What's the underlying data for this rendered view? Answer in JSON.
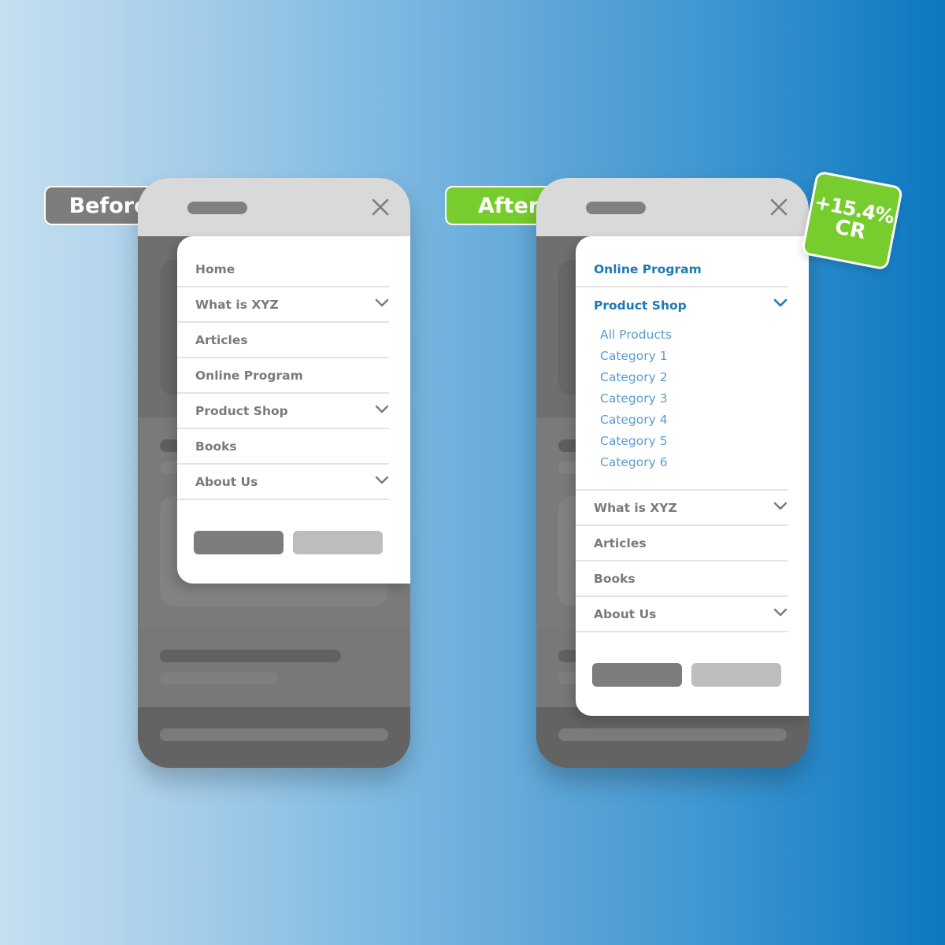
{
  "colors": {
    "accent_blue": "#1e78b8",
    "sub_blue": "#5a9ccd",
    "green": "#77cc2e",
    "grey_tag": "#7d7d7d",
    "menu_text": "#7a7a7a"
  },
  "before": {
    "tag_label": "Before",
    "menu_items": [
      {
        "label": "Home",
        "has_chevron": false
      },
      {
        "label": "What is XYZ",
        "has_chevron": true
      },
      {
        "label": "Articles",
        "has_chevron": false
      },
      {
        "label": "Online Program",
        "has_chevron": false
      },
      {
        "label": "Product Shop",
        "has_chevron": true
      },
      {
        "label": "Books",
        "has_chevron": false
      },
      {
        "label": "About Us",
        "has_chevron": true
      }
    ]
  },
  "after": {
    "tag_label": "After",
    "badge": {
      "value": "+15.4%",
      "metric": "CR"
    },
    "menu_items": [
      {
        "label": "Online Program",
        "has_chevron": false,
        "highlighted": true
      },
      {
        "label": "Product Shop",
        "has_chevron": true,
        "highlighted": true,
        "expanded": true,
        "subitems": [
          "All Products",
          "Category 1",
          "Category 2",
          "Category 3",
          "Category 4",
          "Category 5",
          "Category 6"
        ]
      },
      {
        "label": "What is XYZ",
        "has_chevron": true
      },
      {
        "label": "Articles",
        "has_chevron": false
      },
      {
        "label": "Books",
        "has_chevron": false
      },
      {
        "label": "About Us",
        "has_chevron": true
      }
    ]
  }
}
